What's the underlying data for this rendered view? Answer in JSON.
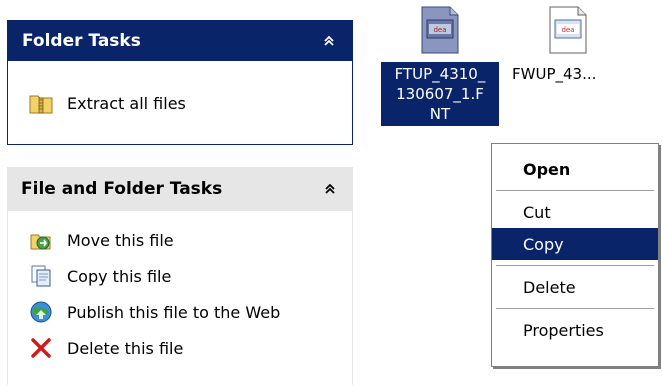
{
  "folder_tasks": {
    "title": "Folder Tasks",
    "items": [
      {
        "label": "Extract all files",
        "icon": "zip-folder-icon"
      }
    ]
  },
  "file_tasks": {
    "title": "File and Folder Tasks",
    "items": [
      {
        "label": "Move this file",
        "icon": "move-icon"
      },
      {
        "label": "Copy this file",
        "icon": "copy-icon"
      },
      {
        "label": "Publish this file to the Web",
        "icon": "globe-icon"
      },
      {
        "label": "Delete this file",
        "icon": "delete-x-icon"
      }
    ]
  },
  "files": [
    {
      "name": "FTUP_4310_ 130607_1.F NT",
      "line1": "FTUP_4310_",
      "line2": "130607_1.F",
      "line3": "NT",
      "selected": true
    },
    {
      "name": "FWUP_43...",
      "selected": false
    }
  ],
  "context_menu": {
    "items": [
      "Open",
      "Cut",
      "Copy",
      "Delete",
      "Properties"
    ],
    "default": "Open",
    "highlighted": "Copy"
  },
  "colors": {
    "selection": "#0a246a",
    "panel_header_gray": "#e6e6e6"
  }
}
